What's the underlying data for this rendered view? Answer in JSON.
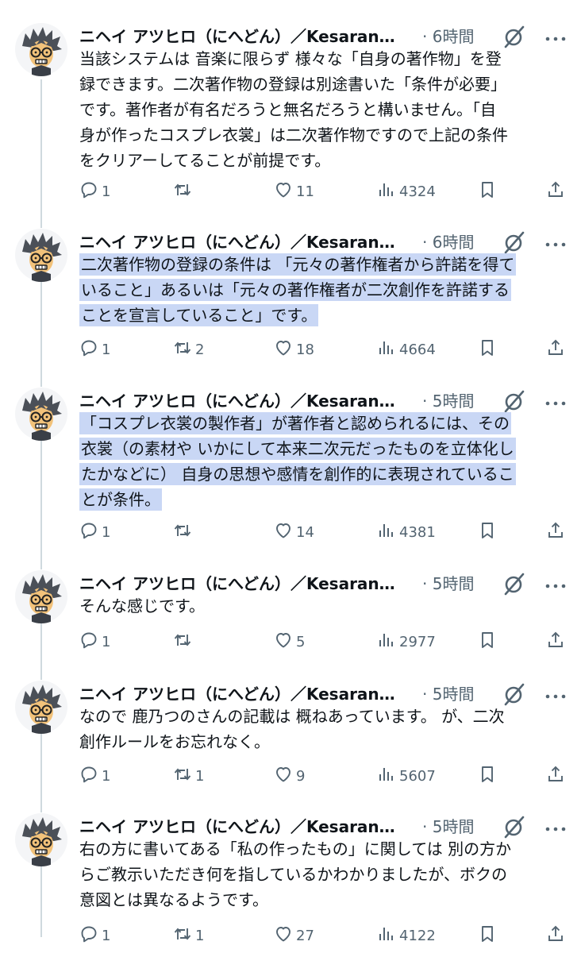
{
  "tweets": [
    {
      "author": "ニヘイ アツヒロ（にへどん）／Kesaran…",
      "time": "· 6時間",
      "highlighted": false,
      "lines": [
        "当該システムは 音楽に限らず 様々な「自身の著作物」を登",
        "録できます。二次著作物の登録は別途書いた「条件が必要」",
        "です。著作者が有名だろうと無名だろうと構いません。「自",
        "身が作ったコスプレ衣裳」は二次著作物ですので上記の条件",
        "をクリアーしてることが前提です。"
      ],
      "replies": "1",
      "retweets": "",
      "likes": "11",
      "views": "4324"
    },
    {
      "author": "ニヘイ アツヒロ（にへどん）／Kesaran…",
      "time": "· 6時間",
      "highlighted": true,
      "lines": [
        "二次著作物の登録の条件は 「元々の著作権者から許諾を得て",
        "いること」あるいは「元々の著作権者が二次創作を許諾する",
        "ことを宣言していること」です。"
      ],
      "replies": "1",
      "retweets": "2",
      "likes": "18",
      "views": "4664"
    },
    {
      "author": "ニヘイ アツヒロ（にへどん）／Kesaran…",
      "time": "· 5時間",
      "highlighted": true,
      "lines": [
        "「コスプレ衣裳の製作者」が著作者と認められるには、その",
        "衣裳（の素材や いかにして本来二次元だったものを立体化し",
        "たかなどに） 自身の思想や感情を創作的に表現されているこ",
        "とが条件。"
      ],
      "replies": "1",
      "retweets": "",
      "likes": "14",
      "views": "4381"
    },
    {
      "author": "ニヘイ アツヒロ（にへどん）／Kesaran…",
      "time": "· 5時間",
      "highlighted": false,
      "lines": [
        "そんな感じです。"
      ],
      "replies": "1",
      "retweets": "",
      "likes": "5",
      "views": "2977"
    },
    {
      "author": "ニヘイ アツヒロ（にへどん）／Kesaran…",
      "time": "· 5時間",
      "highlighted": false,
      "lines": [
        "なので 鹿乃つのさんの記載は 概ねあっています。 が、二次",
        "創作ルールをお忘れなく。"
      ],
      "replies": "1",
      "retweets": "1",
      "likes": "9",
      "views": "5607"
    },
    {
      "author": "ニヘイ アツヒロ（にへどん）／Kesaran…",
      "time": "· 5時間",
      "highlighted": false,
      "lines": [
        "右の方に書いてある「私の作ったもの」に関しては 別の方か",
        "らご教示いただき何を指しているかわかりましたが、ボクの",
        "意図とは異なるようです。"
      ],
      "replies": "1",
      "retweets": "1",
      "likes": "27",
      "views": "4122"
    }
  ],
  "icons": {
    "avatar": "cartoon-avatar-glasses",
    "grok": "grok-icon",
    "more": "more-icon",
    "reply": "reply-icon",
    "retweet": "retweet-icon",
    "like": "heart-icon",
    "views": "views-icon",
    "bookmark": "bookmark-icon",
    "share": "share-icon"
  },
  "colors": {
    "text": "#0f1419",
    "secondary": "#536471",
    "highlight": "#c9d7f5",
    "thread_line": "#cfd9de"
  }
}
